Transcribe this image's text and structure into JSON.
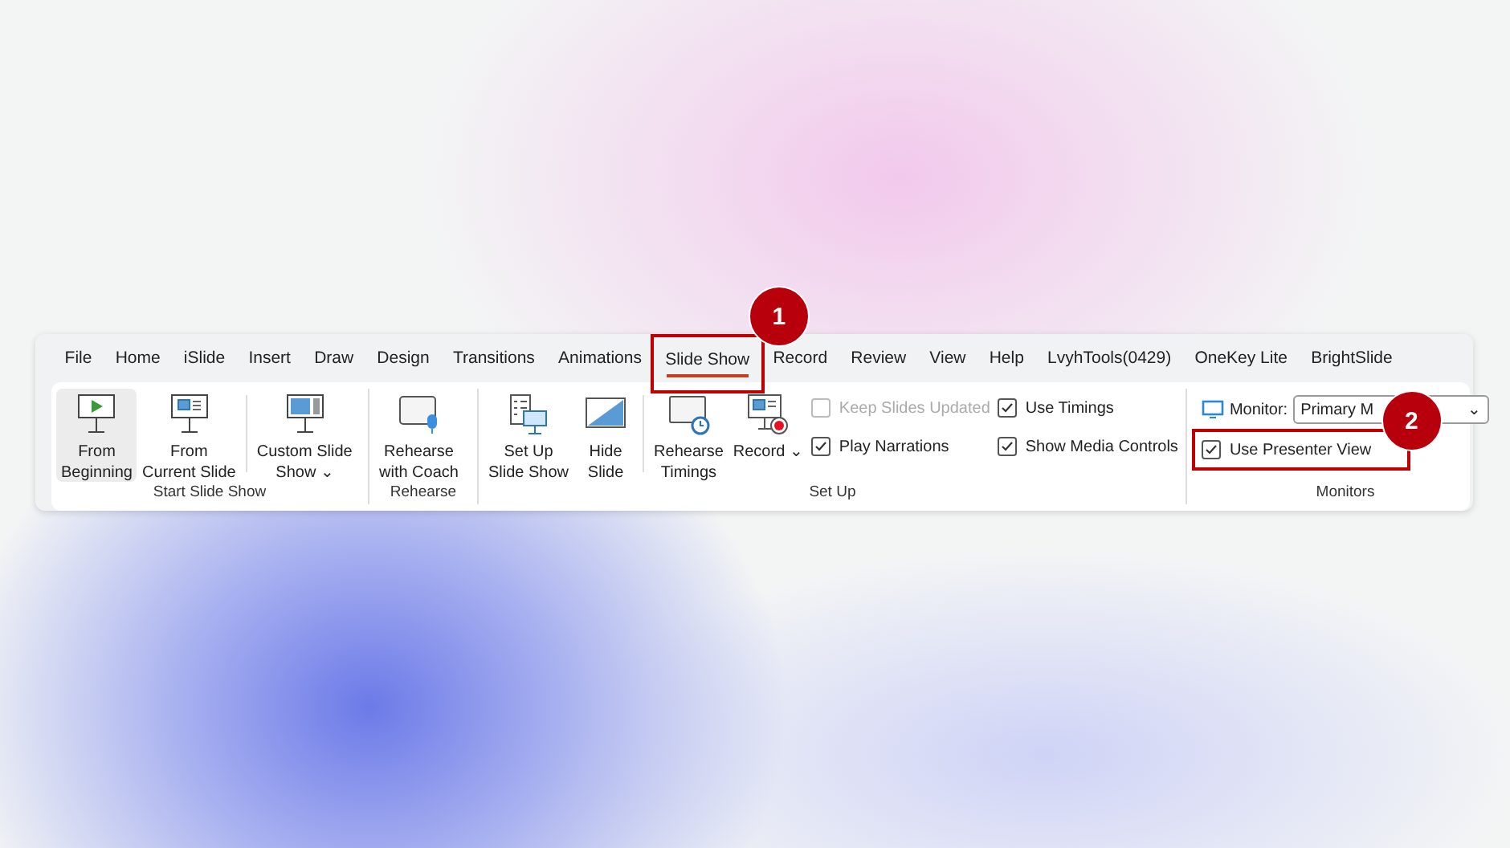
{
  "tabs": [
    {
      "label": "File",
      "selected": false
    },
    {
      "label": "Home",
      "selected": false
    },
    {
      "label": "iSlide",
      "selected": false
    },
    {
      "label": "Insert",
      "selected": false
    },
    {
      "label": "Draw",
      "selected": false
    },
    {
      "label": "Design",
      "selected": false
    },
    {
      "label": "Transitions",
      "selected": false
    },
    {
      "label": "Animations",
      "selected": false
    },
    {
      "label": "Slide Show",
      "selected": true,
      "badge": "1"
    },
    {
      "label": "Record",
      "selected": false
    },
    {
      "label": "Review",
      "selected": false
    },
    {
      "label": "View",
      "selected": false
    },
    {
      "label": "Help",
      "selected": false
    },
    {
      "label": "LvyhTools(0429)",
      "selected": false
    },
    {
      "label": "OneKey Lite",
      "selected": false
    },
    {
      "label": "BrightSlide",
      "selected": false
    }
  ],
  "groups": [
    {
      "label": "Start Slide Show",
      "items": [
        {
          "kind": "big",
          "lines": [
            "From",
            "Beginning"
          ],
          "highlighted": true
        },
        {
          "kind": "big",
          "lines": [
            "From",
            "Current Slide"
          ],
          "highlighted": false
        },
        {
          "kind": "separator"
        },
        {
          "kind": "big",
          "lines": [
            "Custom Slide",
            "Show"
          ],
          "highlighted": false,
          "dropdown": "⌄"
        }
      ]
    },
    {
      "label": "Rehearse",
      "items": [
        {
          "kind": "big",
          "lines": [
            "Rehearse",
            "with Coach"
          ],
          "highlighted": false
        }
      ]
    },
    {
      "label": "Set Up",
      "items": [
        {
          "kind": "big",
          "lines": [
            "Set Up",
            "Slide Show"
          ],
          "highlighted": false
        },
        {
          "kind": "big",
          "lines": [
            "Hide",
            "Slide"
          ],
          "highlighted": false
        },
        {
          "kind": "separator"
        },
        {
          "kind": "big",
          "lines": [
            "Rehearse",
            "Timings"
          ],
          "highlighted": false
        },
        {
          "kind": "big",
          "lines": [
            "Record"
          ],
          "highlighted": false,
          "dropdown": "⌄"
        },
        {
          "kind": "checks",
          "checks": [
            {
              "label": "Keep Slides Updated",
              "checked": false,
              "disabled": true
            },
            {
              "label": "Play Narrations",
              "checked": true,
              "disabled": false
            }
          ]
        },
        {
          "kind": "checks",
          "checks": [
            {
              "label": "Use Timings",
              "checked": true,
              "disabled": false
            },
            {
              "label": "Show Media Controls",
              "checked": true,
              "disabled": false
            }
          ]
        }
      ]
    },
    {
      "label": "Monitors",
      "items": [
        {
          "kind": "monitor",
          "label": "Monitor:",
          "value": "Primary M",
          "caret": "⌄",
          "check": {
            "label": "Use Presenter View",
            "checked": true,
            "disabled": false,
            "badge": "2"
          }
        }
      ]
    }
  ]
}
